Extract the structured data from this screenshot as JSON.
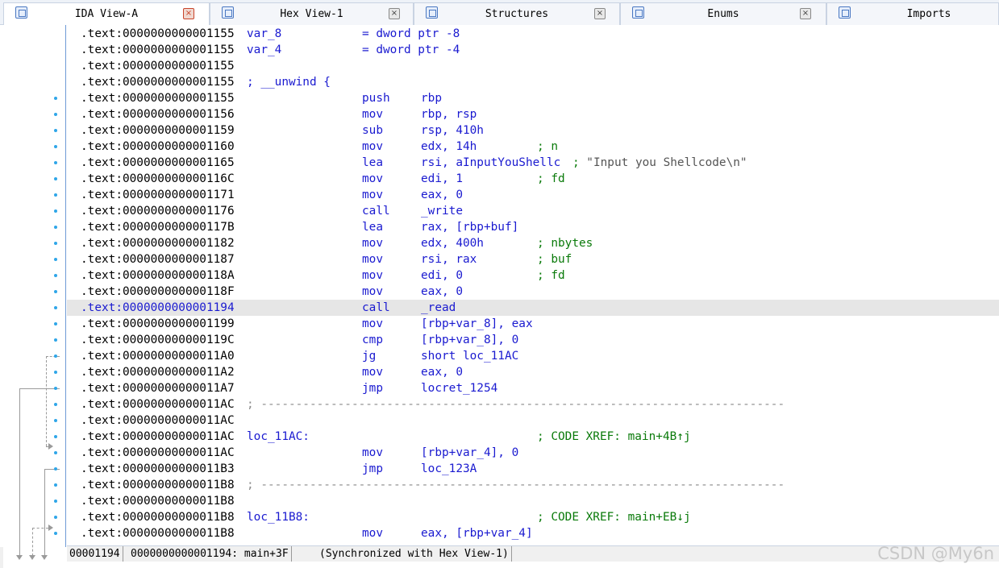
{
  "tabs": [
    {
      "label": "IDA View-A",
      "active": true,
      "icon": "ida-view-icon"
    },
    {
      "label": "Hex View-1",
      "active": false,
      "icon": "hex-view-icon"
    },
    {
      "label": "Structures",
      "active": false,
      "icon": "structures-icon"
    },
    {
      "label": "Enums",
      "active": false,
      "icon": "enums-icon"
    },
    {
      "label": "Imports",
      "active": false,
      "icon": "imports-icon"
    }
  ],
  "tab_close_glyph": "×",
  "collapse_glyph": "⌄",
  "listing": [
    {
      "addr": ".text:0000000000001155",
      "label": "var_8",
      "eq": "= dword ptr -8"
    },
    {
      "addr": ".text:0000000000001155",
      "label": "var_4",
      "eq": "= dword ptr -4"
    },
    {
      "addr": ".text:0000000000001155"
    },
    {
      "addr": ".text:0000000000001155",
      "unwind": "; __unwind {"
    },
    {
      "addr": ".text:0000000000001155",
      "mnem": "push",
      "ops": "rbp"
    },
    {
      "addr": ".text:0000000000001156",
      "mnem": "mov",
      "ops": "rbp, rsp"
    },
    {
      "addr": ".text:0000000000001159",
      "mnem": "sub",
      "ops": "rsp, 410h"
    },
    {
      "addr": ".text:0000000000001160",
      "mnem": "mov",
      "ops": "edx, 14h",
      "comment": "; n"
    },
    {
      "addr": ".text:0000000000001165",
      "mnem": "lea",
      "ops": "rsi, aInputYouShellc",
      "comment": "; ",
      "string": "\"Input you Shellcode\\n\""
    },
    {
      "addr": ".text:000000000000116C",
      "mnem": "mov",
      "ops": "edi, 1",
      "comment": "; fd"
    },
    {
      "addr": ".text:0000000000001171",
      "mnem": "mov",
      "ops": "eax, 0"
    },
    {
      "addr": ".text:0000000000001176",
      "mnem": "call",
      "ops": "_write"
    },
    {
      "addr": ".text:000000000000117B",
      "mnem": "lea",
      "ops": "rax, [rbp+buf]"
    },
    {
      "addr": ".text:0000000000001182",
      "mnem": "mov",
      "ops": "edx, 400h",
      "comment": "; nbytes"
    },
    {
      "addr": ".text:0000000000001187",
      "mnem": "mov",
      "ops": "rsi, rax",
      "comment": "; buf"
    },
    {
      "addr": ".text:000000000000118A",
      "mnem": "mov",
      "ops": "edi, 0",
      "comment": "; fd"
    },
    {
      "addr": ".text:000000000000118F",
      "mnem": "mov",
      "ops": "eax, 0"
    },
    {
      "addr": ".text:0000000000001194",
      "mnem": "call",
      "ops": "_read",
      "highlight": true
    },
    {
      "addr": ".text:0000000000001199",
      "mnem": "mov",
      "ops": "[rbp+var_8], eax"
    },
    {
      "addr": ".text:000000000000119C",
      "mnem": "cmp",
      "ops": "[rbp+var_8], 0"
    },
    {
      "addr": ".text:00000000000011A0",
      "mnem": "jg",
      "ops": "short loc_11AC"
    },
    {
      "addr": ".text:00000000000011A2",
      "mnem": "mov",
      "ops": "eax, 0"
    },
    {
      "addr": ".text:00000000000011A7",
      "mnem": "jmp",
      "ops": "locret_1254"
    },
    {
      "addr": ".text:00000000000011AC",
      "separator": "; ---------------------------------------------------------------------------"
    },
    {
      "addr": ".text:00000000000011AC"
    },
    {
      "addr": ".text:00000000000011AC",
      "label": "loc_11AC:",
      "xref": "; CODE XREF: main+4B↑j"
    },
    {
      "addr": ".text:00000000000011AC",
      "mnem": "mov",
      "ops": "[rbp+var_4], 0"
    },
    {
      "addr": ".text:00000000000011B3",
      "mnem": "jmp",
      "ops": "loc_123A"
    },
    {
      "addr": ".text:00000000000011B8",
      "separator": "; ---------------------------------------------------------------------------"
    },
    {
      "addr": ".text:00000000000011B8"
    },
    {
      "addr": ".text:00000000000011B8",
      "label": "loc_11B8:",
      "xref": "; CODE XREF: main+EB↓j"
    },
    {
      "addr": ".text:00000000000011B8",
      "mnem": "mov",
      "ops": "eax, [rbp+var_4]"
    }
  ],
  "status": {
    "offset": "00001194",
    "location": "0000000000001194: main+3F",
    "sync": "(Synchronized with Hex View-1)"
  },
  "watermark": "CSDN @My6n"
}
